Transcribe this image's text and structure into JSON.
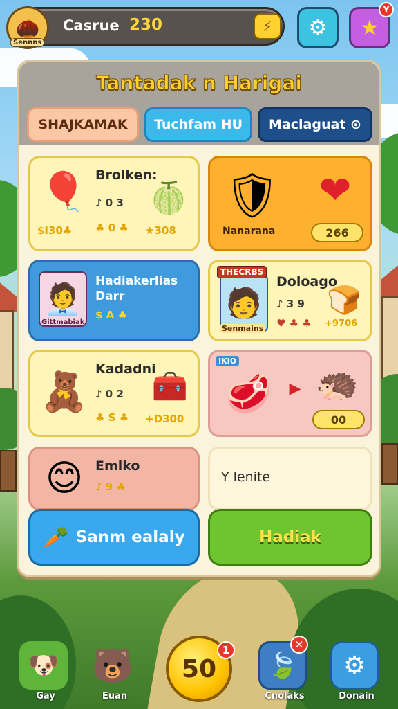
{
  "topbar": {
    "avatar_label": "Sennns",
    "player_name": "Casrue",
    "coins": "230",
    "btn_glyph": "⚡"
  },
  "settings_glyph": "⚙",
  "star_glyph": "★",
  "star_badge": "Y",
  "panel": {
    "title": "Tantadak n Harigai"
  },
  "tabs": [
    {
      "label": "SHAJKAMAK",
      "bg": "#fbc7a5",
      "color": "#5a2d12",
      "border": "#e9a07a"
    },
    {
      "label": "Tuchfam HU",
      "bg": "#3cb8ea",
      "color": "#ffffff",
      "border": "#1c86b8"
    },
    {
      "label": "Maclaguat ⊙",
      "bg": "#1f4f8a",
      "color": "#ffffff",
      "border": "#123463"
    }
  ],
  "cards": {
    "c1": {
      "title": "Brolken:",
      "line": "♪ 0 3",
      "stat": "♣ 0 ♣",
      "price": "$I30♣",
      "extra": "★308"
    },
    "c2": {
      "label": "Nanarana",
      "pill": "266"
    },
    "c3": {
      "title": "Hadiakerlias",
      "title2": "Darr",
      "price": "$ A ♣",
      "portrait_label": "Gittmabiak"
    },
    "c4": {
      "banner": "THECRBS",
      "title": "Doloago",
      "line": "♪ 3 9",
      "stat": "♥ ♣ ♣",
      "extra": "+9706",
      "portrait_label": "Senmains"
    },
    "c5": {
      "title": "Kadadni",
      "line": "♪ 0 2",
      "stat": "♣ S ♣",
      "extra": "+D300"
    },
    "c6": {
      "tag": "IKIO",
      "pill": "00"
    },
    "c7": {
      "title": "Emlko",
      "stat": "♪ 9 ♣"
    },
    "c8": {
      "text": "Y lenite"
    }
  },
  "buttons": {
    "left": "Sanm ealaly",
    "right": "Hadiak"
  },
  "dock": [
    {
      "label": "Gay",
      "bg": "#5fb43a"
    },
    {
      "label": "Euan",
      "bg": "transparent"
    },
    {
      "label": "Cnolaks",
      "bg": "#3d7fc2"
    },
    {
      "label": "Donain",
      "bg": "#3c9ee0"
    }
  ],
  "center_coin": {
    "value": "50",
    "badge": "1"
  },
  "cnolaks_badge": "✕"
}
